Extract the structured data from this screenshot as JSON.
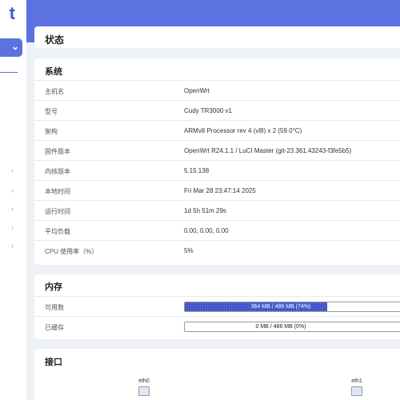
{
  "brand": {
    "text": "t"
  },
  "page": {
    "title": "状态"
  },
  "system": {
    "title": "系统",
    "rows": [
      {
        "label": "主机名",
        "value": "OpenWrt"
      },
      {
        "label": "型号",
        "value": "Cudy TR3000 v1"
      },
      {
        "label": "架构",
        "value": "ARMv8 Processor rev 4 (v8l) x 2 (59.0°C)"
      },
      {
        "label": "固件版本",
        "value": "OpenWrt R24.1.1 / LuCI Master (git-23.361.43243-f3fe5b5)"
      },
      {
        "label": "内核版本",
        "value": "5.15.138"
      },
      {
        "label": "本地时间",
        "value": "Fri Mar 28 23:47:14 2025"
      },
      {
        "label": "运行时间",
        "value": "1d 5h 51m 29s"
      },
      {
        "label": "平均负载",
        "value": "0.00, 0.00, 0.00"
      },
      {
        "label": "CPU 使用率（%）",
        "value": "5%"
      }
    ]
  },
  "memory": {
    "title": "内存",
    "rows": [
      {
        "label": "可用数",
        "bar_text": "364 MB / 486 MB (74%)",
        "percent": 74
      },
      {
        "label": "已缓存",
        "bar_text": "0 MB / 486 MB (0%)",
        "percent": 0
      }
    ]
  },
  "interfaces": {
    "title": "接口",
    "items": [
      {
        "name": "eth0",
        "icon": "ethernet-port-icon"
      },
      {
        "name": "eth1",
        "icon": "ethernet-port-icon"
      }
    ]
  },
  "colors": {
    "accent": "#5b72e0",
    "bar_fill": "#3f55c9"
  }
}
